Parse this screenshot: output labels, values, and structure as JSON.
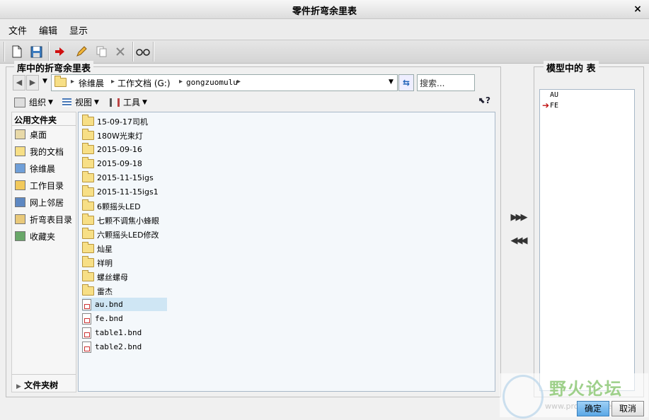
{
  "window": {
    "title": "零件折弯余里表",
    "close": "×"
  },
  "menu": [
    "文件",
    "编辑",
    "显示"
  ],
  "toolbar": {
    "icons": [
      "new-file-icon",
      "save-icon",
      "red-arrow-icon",
      "pencil-icon",
      "copy-icon",
      "delete-icon",
      "glasses-icon"
    ]
  },
  "library": {
    "label": "库中的折弯余里表",
    "path": [
      "徐维晨",
      "工作文档 (G:)",
      "gongzuomulu"
    ],
    "search_placeholder": "搜索...",
    "organize": "组织",
    "view": "视图",
    "tools": "工具",
    "favorites_header": "公用文件夹",
    "favorites": [
      "桌面",
      "我的文档",
      "徐维晨",
      "工作目录",
      "网上邻居",
      "折弯表目录",
      "收藏夹"
    ],
    "folder_tree": "文件夹树",
    "files": [
      {
        "name": "15-09-17司机",
        "type": "folder"
      },
      {
        "name": "180W光束灯",
        "type": "folder"
      },
      {
        "name": "2015-09-16",
        "type": "folder"
      },
      {
        "name": "2015-09-18",
        "type": "folder"
      },
      {
        "name": "2015-11-15igs",
        "type": "folder"
      },
      {
        "name": "2015-11-15igs1",
        "type": "folder"
      },
      {
        "name": "6颗摇头LED",
        "type": "folder"
      },
      {
        "name": "七颗不调焦小蜂眼",
        "type": "folder"
      },
      {
        "name": "六颗摇头LED修改",
        "type": "folder"
      },
      {
        "name": "灿星",
        "type": "folder"
      },
      {
        "name": "祥明",
        "type": "folder"
      },
      {
        "name": "螺丝螺母",
        "type": "folder"
      },
      {
        "name": "雷杰",
        "type": "folder"
      },
      {
        "name": "au.bnd",
        "type": "file",
        "selected": true
      },
      {
        "name": "fe.bnd",
        "type": "file"
      },
      {
        "name": "table1.bnd",
        "type": "file"
      },
      {
        "name": "table2.bnd",
        "type": "file"
      }
    ]
  },
  "transfer": {
    "add": "▶▶▶",
    "remove": "◀◀◀"
  },
  "model": {
    "label": "模型中的 表",
    "tables": [
      {
        "name": "AU",
        "current": false
      },
      {
        "name": "FE",
        "current": true
      }
    ]
  },
  "buttons": {
    "ok": "确定",
    "cancel": "取消"
  },
  "watermark": {
    "text": "野火论坛",
    "sub": "www.proewildfire.cn"
  }
}
